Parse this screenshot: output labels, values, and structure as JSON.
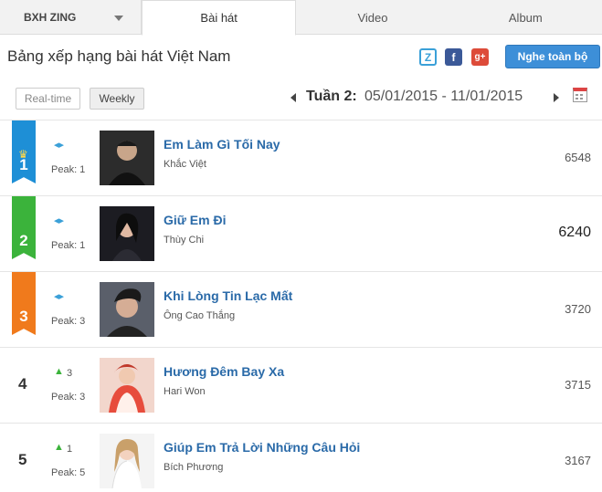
{
  "tabs": {
    "dropdown_label": "BXH ZING",
    "items": [
      {
        "label": "Bài hát"
      },
      {
        "label": "Video"
      },
      {
        "label": "Album"
      }
    ]
  },
  "header": {
    "title": "Bảng xếp hạng bài hát Việt Nam",
    "play_all": "Nghe toàn bộ",
    "share": {
      "zing": "Z",
      "facebook": "f",
      "google": "g+"
    }
  },
  "filters": {
    "realtime": "Real-time",
    "weekly": "Weekly",
    "week_label": "Tuần 2:",
    "week_range": "05/01/2015 - 11/01/2015"
  },
  "songs": [
    {
      "rank": "1",
      "change": "",
      "peak": "Peak: 1",
      "title": "Em Làm Gì Tối Nay",
      "artist": "Khắc Việt",
      "score": "6548",
      "color": "#1e8fd6"
    },
    {
      "rank": "2",
      "change": "",
      "peak": "Peak: 1",
      "title": "Giữ Em Đi",
      "artist": "Thùy Chi",
      "score": "6240",
      "color": "#3bb33b"
    },
    {
      "rank": "3",
      "change": "",
      "peak": "Peak: 3",
      "title": "Khi Lòng Tin Lạc Mất",
      "artist": "Ông Cao Thắng",
      "score": "3720",
      "color": "#f07a1c"
    },
    {
      "rank": "4",
      "change": "3",
      "peak": "Peak: 3",
      "title": "Hương Đêm Bay Xa",
      "artist": "Hari Won",
      "score": "3715"
    },
    {
      "rank": "5",
      "change": "1",
      "peak": "Peak: 5",
      "title": "Giúp Em Trả Lời Những Câu Hỏi",
      "artist": "Bích Phương",
      "score": "3167"
    }
  ],
  "icons": {
    "no_change": "left-right-arrows-icon",
    "up": "arrow-up-icon",
    "crown": "crown-icon",
    "calendar": "calendar-icon"
  }
}
